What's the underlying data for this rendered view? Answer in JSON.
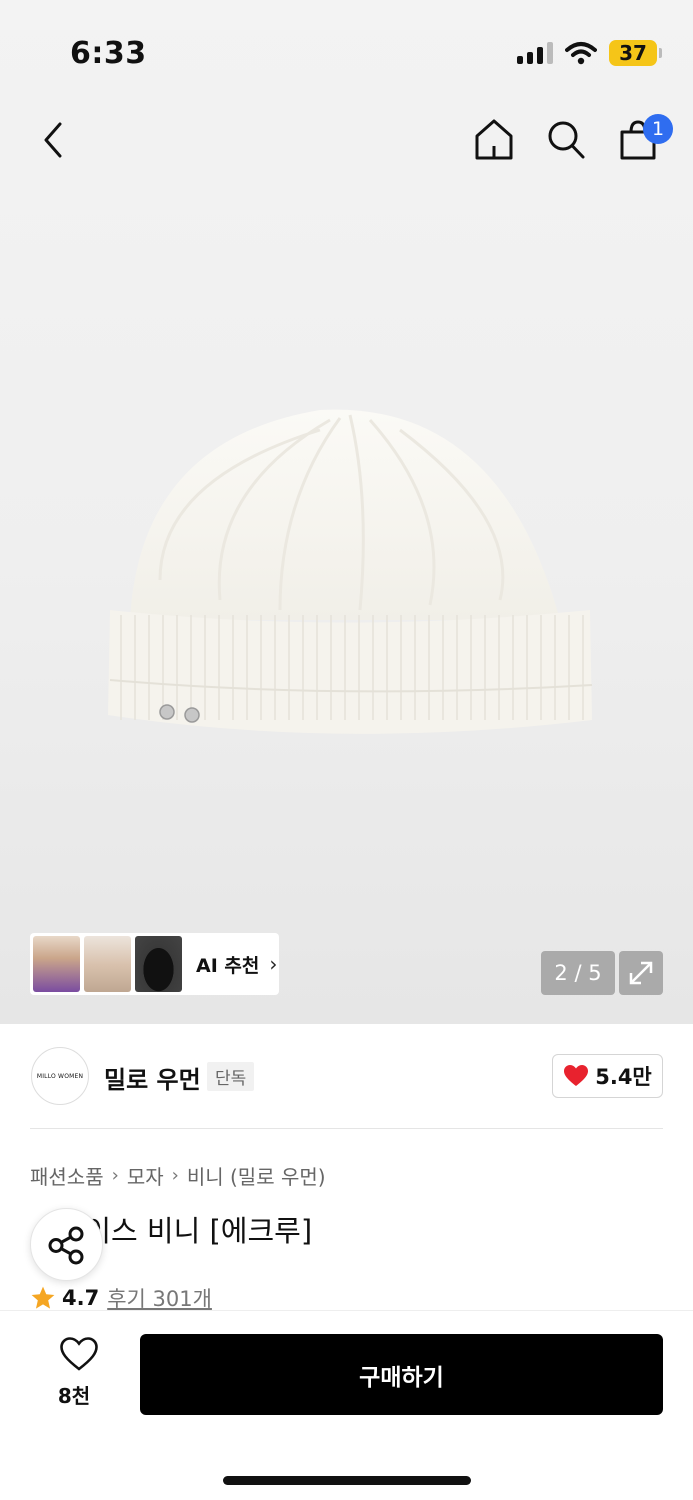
{
  "status_bar": {
    "time": "6:33",
    "battery": "37"
  },
  "nav": {
    "cart_count": "1"
  },
  "gallery": {
    "ai_label": "AI 추천",
    "pager": "2 / 5"
  },
  "brand": {
    "logo_text": "MILLO WOMEN",
    "name": "밀로 우먼",
    "badge": "단독",
    "likes": "5.4만"
  },
  "breadcrumb": [
    "패션소품",
    "모자",
    "비니 (밀로 우먼)"
  ],
  "product": {
    "title": "...레이스 비니 [에크루]",
    "rating": "4.7",
    "reviews": "후기 301개"
  },
  "bottom": {
    "wish_count": "8천",
    "buy_label": "구매하기"
  },
  "colors": {
    "accent_badge": "#2f6df0",
    "heart": "#e8222e",
    "star": "#f5a623",
    "battery": "#f5c518"
  },
  "icons": [
    "back-icon",
    "home-icon",
    "search-icon",
    "cart-icon",
    "expand-icon",
    "share-icon",
    "heart-icon",
    "star-icon"
  ]
}
